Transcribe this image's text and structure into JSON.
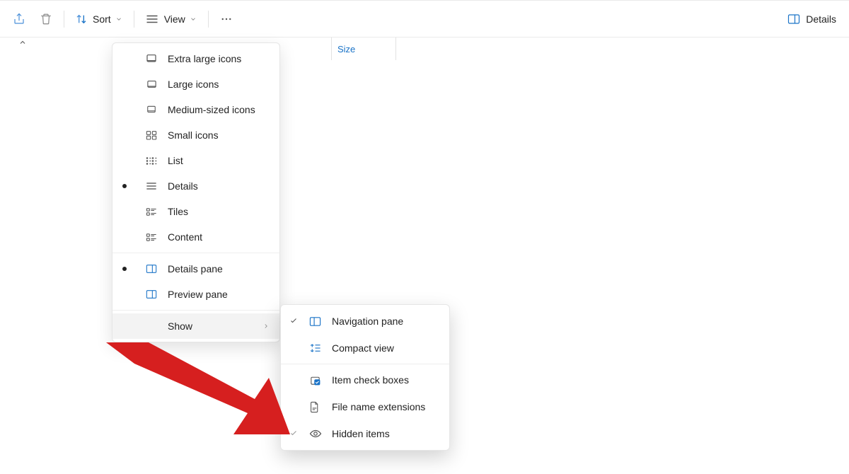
{
  "toolbar": {
    "sort_label": "Sort",
    "view_label": "View",
    "details_label": "Details"
  },
  "column": {
    "size_label": "Size"
  },
  "view_menu": {
    "extra_large": "Extra large icons",
    "large": "Large icons",
    "medium": "Medium-sized icons",
    "small": "Small icons",
    "list": "List",
    "details": "Details",
    "tiles": "Tiles",
    "content": "Content",
    "details_pane": "Details pane",
    "preview_pane": "Preview pane",
    "show": "Show"
  },
  "show_submenu": {
    "navigation_pane": "Navigation pane",
    "compact_view": "Compact view",
    "item_check_boxes": "Item check boxes",
    "file_name_extensions": "File name extensions",
    "hidden_items": "Hidden items"
  }
}
